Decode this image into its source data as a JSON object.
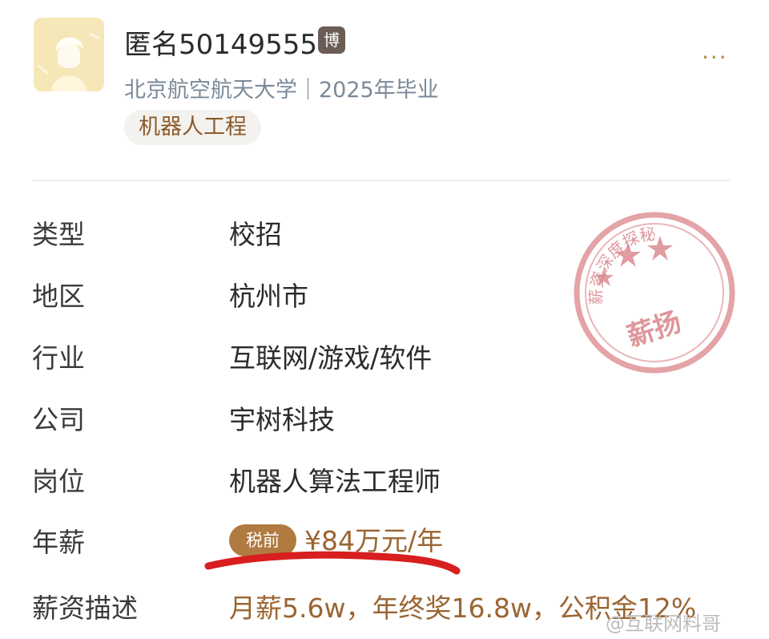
{
  "profile": {
    "username": "匿名50149555",
    "badge": "博",
    "school": "北京航空航天大学｜2025年毕业",
    "major": "机器人工程",
    "more": "···"
  },
  "details": [
    {
      "label": "类型",
      "value": "校招"
    },
    {
      "label": "地区",
      "value": "杭州市"
    },
    {
      "label": "行业",
      "value": "互联网/游戏/软件"
    },
    {
      "label": "公司",
      "value": "宇树科技"
    },
    {
      "label": "岗位",
      "value": "机器人算法工程师"
    }
  ],
  "salary": {
    "label": "年薪",
    "tag": "税前",
    "value": "¥84万元/年"
  },
  "description": {
    "label": "薪资描述",
    "value": "月薪5.6w，年终奖16.8w，公积金12%"
  },
  "stamp": {
    "arc_text": "薪资深度探秘",
    "brand": "薪扬"
  },
  "watermark": "@互联网料哥",
  "colors": {
    "accent": "#b07a40",
    "salary_text": "#9b6532",
    "stamp": "#d9848a",
    "underline": "#d81e1e"
  }
}
